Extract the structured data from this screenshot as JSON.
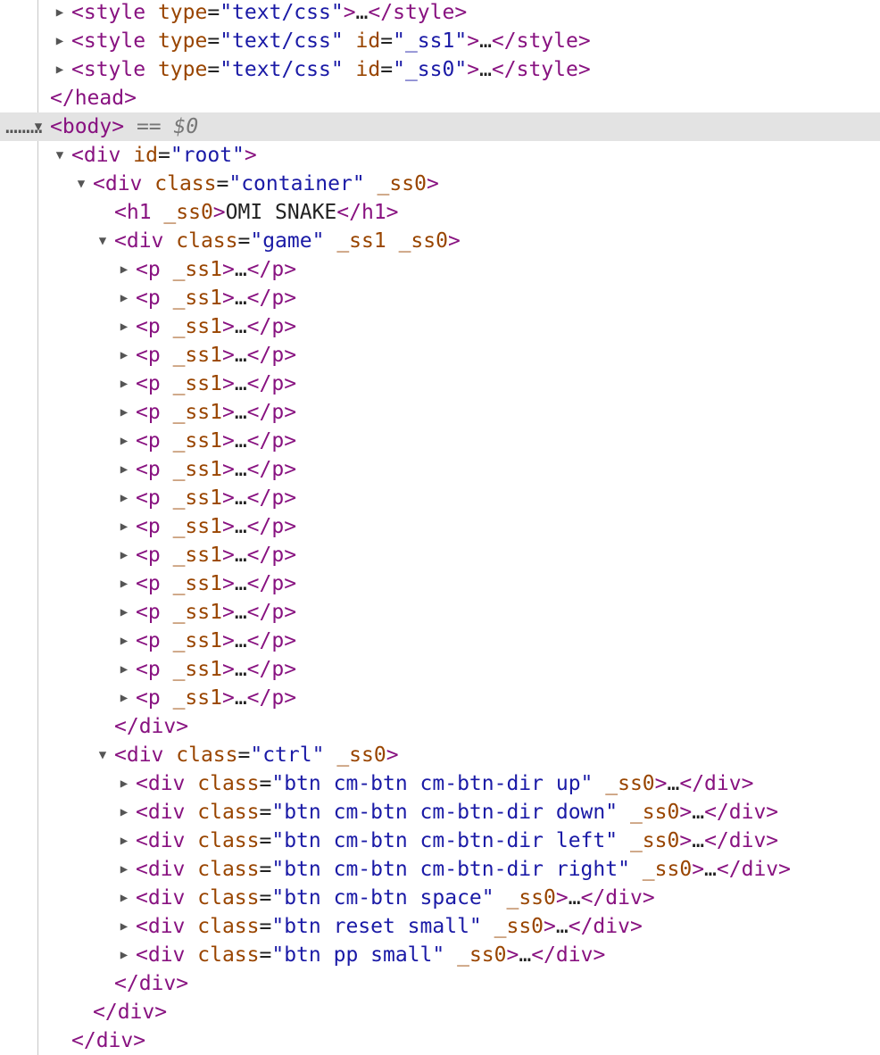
{
  "ellipsis": "…",
  "eq_sign": "=",
  "console_ref": {
    "op": "==",
    "var": "$0"
  },
  "theme": {
    "tag": "#881280",
    "attr": "#994500",
    "value": "#1a1aa6",
    "selected_row": "#e3e3e3"
  },
  "icons": {
    "expanded": "chevron-down-icon",
    "collapsed": "chevron-right-icon"
  },
  "rows": [
    {
      "t": "style",
      "attrs": [
        {
          "n": "type",
          "v": "text/css"
        }
      ],
      "collapsed": true
    },
    {
      "t": "style",
      "attrs": [
        {
          "n": "type",
          "v": "text/css"
        },
        {
          "n": "id",
          "v": "_ss1"
        }
      ],
      "collapsed": true
    },
    {
      "t": "style",
      "attrs": [
        {
          "n": "type",
          "v": "text/css"
        },
        {
          "n": "id",
          "v": "_ss0"
        }
      ],
      "collapsed": true
    },
    {
      "t": "head",
      "close": true
    },
    {
      "t": "body",
      "open": true,
      "selected": true
    },
    {
      "t": "div",
      "attrs": [
        {
          "n": "id",
          "v": "root"
        }
      ],
      "open": true
    },
    {
      "t": "div",
      "attrs": [
        {
          "n": "class",
          "v": "container"
        },
        {
          "n": "_ss0"
        }
      ],
      "open": true
    },
    {
      "t": "h1",
      "attrs": [
        {
          "n": "_ss0"
        }
      ],
      "text": "OMI SNAKE"
    },
    {
      "t": "div",
      "attrs": [
        {
          "n": "class",
          "v": "game"
        },
        {
          "n": "_ss1"
        },
        {
          "n": "_ss0"
        }
      ],
      "open": true
    },
    {
      "t": "p",
      "attrs": [
        {
          "n": "_ss1"
        }
      ],
      "collapsed": true
    },
    {
      "t": "p",
      "attrs": [
        {
          "n": "_ss1"
        }
      ],
      "collapsed": true
    },
    {
      "t": "p",
      "attrs": [
        {
          "n": "_ss1"
        }
      ],
      "collapsed": true
    },
    {
      "t": "p",
      "attrs": [
        {
          "n": "_ss1"
        }
      ],
      "collapsed": true
    },
    {
      "t": "p",
      "attrs": [
        {
          "n": "_ss1"
        }
      ],
      "collapsed": true
    },
    {
      "t": "p",
      "attrs": [
        {
          "n": "_ss1"
        }
      ],
      "collapsed": true
    },
    {
      "t": "p",
      "attrs": [
        {
          "n": "_ss1"
        }
      ],
      "collapsed": true
    },
    {
      "t": "p",
      "attrs": [
        {
          "n": "_ss1"
        }
      ],
      "collapsed": true
    },
    {
      "t": "p",
      "attrs": [
        {
          "n": "_ss1"
        }
      ],
      "collapsed": true
    },
    {
      "t": "p",
      "attrs": [
        {
          "n": "_ss1"
        }
      ],
      "collapsed": true
    },
    {
      "t": "p",
      "attrs": [
        {
          "n": "_ss1"
        }
      ],
      "collapsed": true
    },
    {
      "t": "p",
      "attrs": [
        {
          "n": "_ss1"
        }
      ],
      "collapsed": true
    },
    {
      "t": "p",
      "attrs": [
        {
          "n": "_ss1"
        }
      ],
      "collapsed": true
    },
    {
      "t": "p",
      "attrs": [
        {
          "n": "_ss1"
        }
      ],
      "collapsed": true
    },
    {
      "t": "p",
      "attrs": [
        {
          "n": "_ss1"
        }
      ],
      "collapsed": true
    },
    {
      "t": "p",
      "attrs": [
        {
          "n": "_ss1"
        }
      ],
      "collapsed": true
    },
    {
      "t": "div",
      "close": true
    },
    {
      "t": "div",
      "attrs": [
        {
          "n": "class",
          "v": "ctrl"
        },
        {
          "n": "_ss0"
        }
      ],
      "open": true
    },
    {
      "t": "div",
      "attrs": [
        {
          "n": "class",
          "v": "btn cm-btn cm-btn-dir up"
        },
        {
          "n": "_ss0"
        }
      ],
      "collapsed": true
    },
    {
      "t": "div",
      "attrs": [
        {
          "n": "class",
          "v": "btn cm-btn cm-btn-dir down"
        },
        {
          "n": "_ss0"
        }
      ],
      "collapsed": true
    },
    {
      "t": "div",
      "attrs": [
        {
          "n": "class",
          "v": "btn cm-btn cm-btn-dir left"
        },
        {
          "n": "_ss0"
        }
      ],
      "collapsed": true
    },
    {
      "t": "div",
      "attrs": [
        {
          "n": "class",
          "v": "btn cm-btn cm-btn-dir right"
        },
        {
          "n": "_ss0"
        }
      ],
      "collapsed": true
    },
    {
      "t": "div",
      "attrs": [
        {
          "n": "class",
          "v": "btn cm-btn space"
        },
        {
          "n": "_ss0"
        }
      ],
      "collapsed": true
    },
    {
      "t": "div",
      "attrs": [
        {
          "n": "class",
          "v": "btn reset small"
        },
        {
          "n": "_ss0"
        }
      ],
      "collapsed": true
    },
    {
      "t": "div",
      "attrs": [
        {
          "n": "class",
          "v": "btn pp small"
        },
        {
          "n": "_ss0"
        }
      ],
      "collapsed": true
    },
    {
      "t": "div",
      "close": true
    },
    {
      "t": "div",
      "close": true
    },
    {
      "t": "div",
      "close": true
    }
  ]
}
